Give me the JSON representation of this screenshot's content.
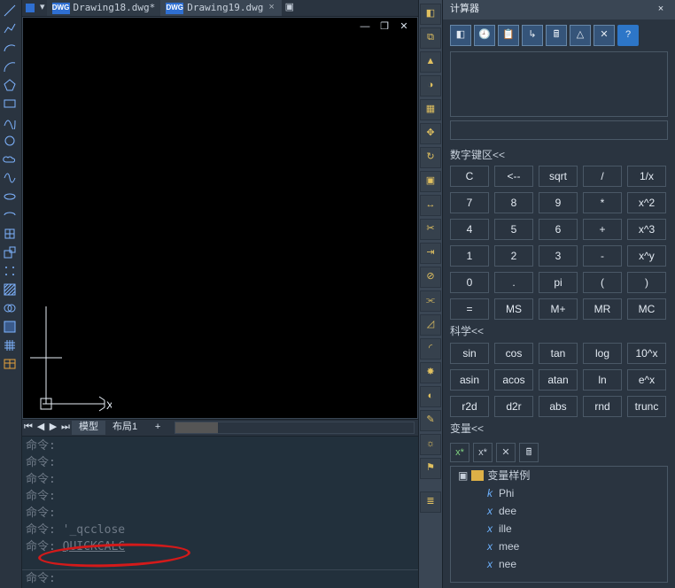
{
  "tabs": {
    "inactive": "Drawing18.dwg*",
    "active": "Drawing19.dwg",
    "badge": "DWG"
  },
  "view": {
    "axis_x_label": "X"
  },
  "bottom_tabs": {
    "model": "模型",
    "layout1": "布局1"
  },
  "cmd": {
    "prefix": "命令:",
    "qcclose": "'_qcclose",
    "quickcalc": "QUICKCALC",
    "prompt": "命令:"
  },
  "calc": {
    "title": "计算器",
    "input_value": "",
    "numpad_title": "数字键区<<",
    "keys": [
      "C",
      "<--",
      "sqrt",
      "/",
      "1/x",
      "7",
      "8",
      "9",
      "*",
      "x^2",
      "4",
      "5",
      "6",
      "+",
      "x^3",
      "1",
      "2",
      "3",
      "-",
      "x^y",
      "0",
      ".",
      "pi",
      "(",
      ")",
      "=",
      "MS",
      "M+",
      "MR",
      "MC"
    ],
    "sci_title": "科学<<",
    "sci_keys": [
      "sin",
      "cos",
      "tan",
      "log",
      "10^x",
      "asin",
      "acos",
      "atan",
      "ln",
      "e^x",
      "r2d",
      "d2r",
      "abs",
      "rnd",
      "trunc"
    ],
    "vars_title": "变量<<",
    "var_root": "变量样例",
    "var_items": [
      "Phi",
      "dee",
      "ille",
      "mee",
      "nee"
    ]
  }
}
